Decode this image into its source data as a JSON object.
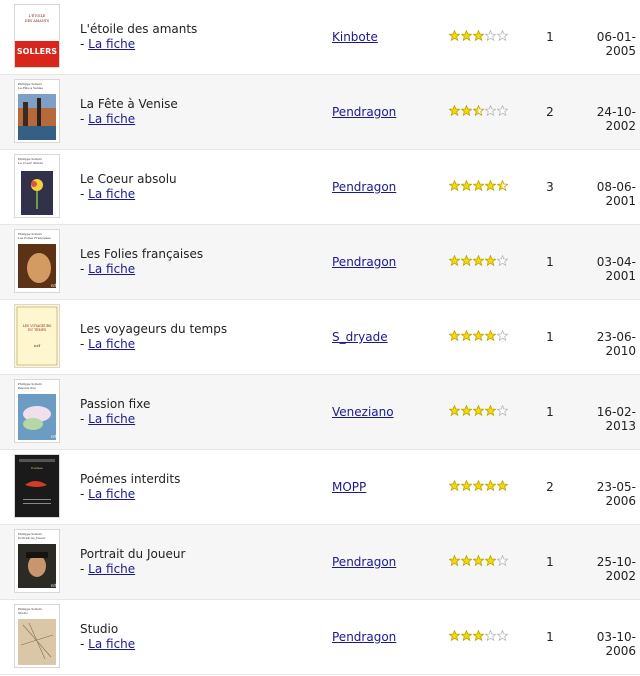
{
  "colors": {
    "link": "#1a1a8e",
    "star_on": "#f5d90a",
    "star_off": "#ffffff",
    "star_stroke": "#b7a100",
    "star_off_stroke": "#b5b5b5"
  },
  "books": [
    {
      "title": "L'étoile des amants",
      "fiche_prefix": "- ",
      "fiche": "La fiche",
      "author": "Kinbote",
      "rating": 3,
      "count": "1",
      "date": "06-01-2005",
      "cover": {
        "bg": "#ffffff",
        "band": "#d8261c",
        "band_text": "SOLLERS",
        "cover_title": "L'ÉTOILE DES AMANTS",
        "cover_small": "",
        "art": "none"
      }
    },
    {
      "title": "La Fête à Venise",
      "fiche_prefix": "- ",
      "fiche": "La fiche",
      "author": "Pendragon",
      "rating": 2.5,
      "count": "2",
      "date": "24-10-2002",
      "cover": {
        "bg": "#ffffff",
        "cover_small": "Philippe Sollers",
        "cover_title": "La Fête à Venise",
        "art": "venice"
      }
    },
    {
      "title": "Le Coeur absolu",
      "fiche_prefix": "- ",
      "fiche": "La fiche",
      "author": "Pendragon",
      "rating": 4.5,
      "count": "3",
      "date": "08-06-2001",
      "cover": {
        "bg": "#ffffff",
        "cover_small": "Philippe Sollers",
        "cover_title": "Le Coeur Absolu",
        "art": "flower"
      }
    },
    {
      "title": "Les Folies françaises",
      "fiche_prefix": "- ",
      "fiche": "La fiche",
      "author": "Pendragon",
      "rating": 4,
      "count": "1",
      "date": "03-04-2001",
      "cover": {
        "bg": "#ffffff",
        "cover_small": "Philippe Sollers",
        "cover_title": "Les Folies Françaises",
        "art": "face"
      }
    },
    {
      "title": "Les voyageurs du temps",
      "fiche_prefix": "- ",
      "fiche": "La fiche",
      "author": "S_dryade",
      "rating": 4,
      "count": "1",
      "date": "23-06-2010",
      "cover": {
        "bg": "#fdf6cf",
        "cover_small": "",
        "cover_title": "LES VOYAGEURS DU TEMPS",
        "art": "nrf"
      }
    },
    {
      "title": "Passion fixe",
      "fiche_prefix": "- ",
      "fiche": "La fiche",
      "author": "Veneziano",
      "rating": 4,
      "count": "1",
      "date": "16-02-2013",
      "cover": {
        "bg": "#ffffff",
        "cover_small": "Philippe Sollers",
        "cover_title": "Passion fixe",
        "art": "painting"
      }
    },
    {
      "title": "Poémes interdits",
      "fiche_prefix": "- ",
      "fiche": "La fiche",
      "author": "MOPP",
      "rating": 5,
      "count": "2",
      "date": "23-05-2006",
      "cover": {
        "bg": "#1a1a1a",
        "cover_small": "",
        "cover_title": "",
        "art": "dark"
      }
    },
    {
      "title": "Portrait du Joueur",
      "fiche_prefix": "- ",
      "fiche": "La fiche",
      "author": "Pendragon",
      "rating": 4,
      "count": "1",
      "date": "25-10-2002",
      "cover": {
        "bg": "#ffffff",
        "cover_small": "Philippe Sollers",
        "cover_title": "Portrait du Joueur",
        "art": "portrait"
      }
    },
    {
      "title": "Studio",
      "fiche_prefix": "- ",
      "fiche": "La fiche",
      "author": "Pendragon",
      "rating": 3,
      "count": "1",
      "date": "03-10-2006",
      "cover": {
        "bg": "#ffffff",
        "cover_small": "Philippe Sollers",
        "cover_title": "Studio",
        "art": "sketch"
      }
    }
  ]
}
